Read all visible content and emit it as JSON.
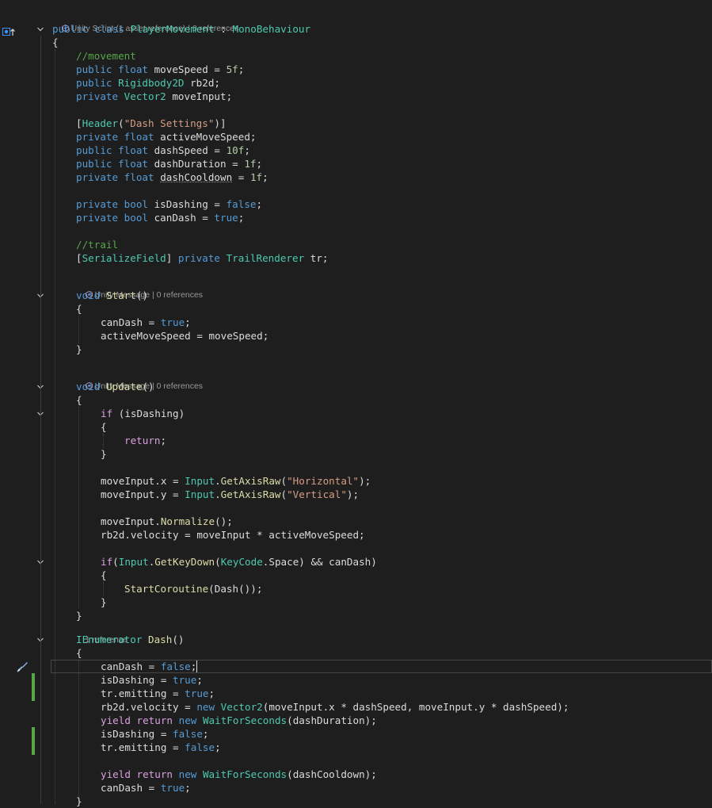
{
  "codelens": {
    "class_lens": "Unity Script (1 asset reference) | 0 references",
    "start_lens": "Unity Message | 0 references",
    "update_lens": "Unity Message | 0 references",
    "dash_lens": "1 reference"
  },
  "code": {
    "l01": [
      "public",
      " ",
      "class",
      " ",
      "PlayerMovement",
      " : ",
      "MonoBehaviour"
    ],
    "l02": "{",
    "l03": "//movement",
    "l04": [
      "public",
      " ",
      "float",
      " moveSpeed = ",
      "5f",
      ";"
    ],
    "l05": [
      "public",
      " ",
      "Rigidbody2D",
      " rb2d;"
    ],
    "l06": [
      "private",
      " ",
      "Vector2",
      " moveInput;"
    ],
    "l07": [
      "[",
      "Header",
      "(",
      "\"Dash Settings\"",
      ")]"
    ],
    "l08": [
      "private",
      " ",
      "float",
      " activeMoveSpeed;"
    ],
    "l09": [
      "public",
      " ",
      "float",
      " dashSpeed = ",
      "10f",
      ";"
    ],
    "l10": [
      "public",
      " ",
      "float",
      " dashDuration = ",
      "1f",
      ";"
    ],
    "l11": [
      "private",
      " ",
      "float",
      " ",
      "dashCooldown",
      " = ",
      "1f",
      ";"
    ],
    "l12": [
      "private",
      " ",
      "bool",
      " isDashing = ",
      "false",
      ";"
    ],
    "l13": [
      "private",
      " ",
      "bool",
      " canDash = ",
      "true",
      ";"
    ],
    "l14": "//trail",
    "l15": [
      "[",
      "SerializeField",
      "] ",
      "private",
      " ",
      "TrailRenderer",
      " tr;"
    ],
    "l16": [
      "void",
      " ",
      "Start",
      "()"
    ],
    "l17": "{",
    "l18": [
      "canDash = ",
      "true",
      ";"
    ],
    "l19": "activeMoveSpeed = moveSpeed;",
    "l20": "}",
    "l21": [
      "void",
      " ",
      "Update",
      "()"
    ],
    "l22": "{",
    "l23": [
      "if",
      " (isDashing)"
    ],
    "l24": "{",
    "l25": [
      "return",
      ";"
    ],
    "l26": "}",
    "l27": [
      "moveInput.x = ",
      "Input",
      ".",
      "GetAxisRaw",
      "(",
      "\"Horizontal\"",
      ");"
    ],
    "l28": [
      "moveInput.y = ",
      "Input",
      ".",
      "GetAxisRaw",
      "(",
      "\"Vertical\"",
      ");"
    ],
    "l29": [
      "moveInput.",
      "Normalize",
      "();"
    ],
    "l30": "rb2d.velocity = moveInput * activeMoveSpeed;",
    "l31": [
      "if",
      "(",
      "Input",
      ".",
      "GetKeyDown",
      "(",
      "KeyCode",
      ".Space) && canDash)"
    ],
    "l32": "{",
    "l33": [
      "StartCoroutine",
      "(Dash());"
    ],
    "l34": "}",
    "l35": "}",
    "l36": [
      "IEnumerator",
      " ",
      "Dash",
      "()"
    ],
    "l37": "{",
    "l38": [
      "canDash = ",
      "false",
      ";"
    ],
    "l39": [
      "isDashing = ",
      "true",
      ";"
    ],
    "l40": [
      "tr.emitting = ",
      "true",
      ";"
    ],
    "l41": [
      "rb2d.velocity = ",
      "new",
      " ",
      "Vector2",
      "(moveInput.x * dashSpeed, moveInput.y * dashSpeed);"
    ],
    "l42": [
      "yield",
      " ",
      "return",
      " ",
      "new",
      " ",
      "WaitForSeconds",
      "(dashDuration);"
    ],
    "l43": [
      "isDashing = ",
      "false",
      ";"
    ],
    "l44": [
      "tr.emitting = ",
      "false",
      ";"
    ],
    "l45": [
      "yield",
      " ",
      "return",
      " ",
      "new",
      " ",
      "WaitForSeconds",
      "(dashCooldown);"
    ],
    "l46": [
      "canDash = ",
      "true",
      ";"
    ],
    "l47": "}"
  },
  "colors": {
    "background": "#1e1e1e",
    "keyword": "#569cd6",
    "control_keyword": "#d8a0df",
    "type": "#4ec9b0",
    "comment": "#57a64a",
    "string": "#d69d85",
    "number": "#b5cea8",
    "method": "#dcdcaa",
    "change_bar": "#57a64a"
  },
  "icons": [
    "bookmark-override-icon",
    "fold-chevron-icon",
    "unity-icon",
    "quick-action-screwdriver-icon"
  ]
}
